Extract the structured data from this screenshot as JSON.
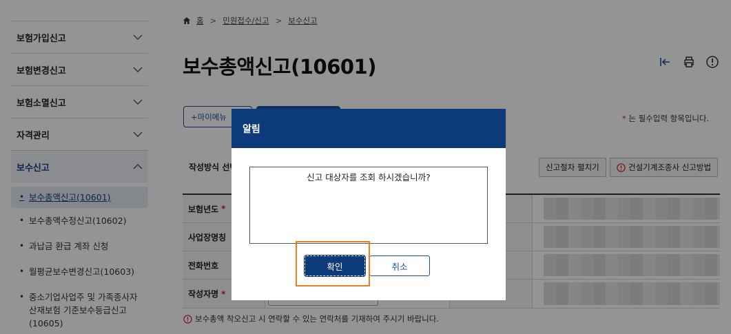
{
  "sidebar": {
    "items": [
      {
        "label": "보험가입신고"
      },
      {
        "label": "보험변경신고"
      },
      {
        "label": "보험소멸신고"
      },
      {
        "label": "자격관리"
      },
      {
        "label": "보수신고"
      }
    ],
    "sub_items": [
      {
        "label": "보수총액신고(10601)"
      },
      {
        "label": "보수총액수정신고(10602)"
      },
      {
        "label": "과납금 환급 계좌 신청"
      },
      {
        "label": "월평균보수변경신고(10603)"
      },
      {
        "label": "중소기업사업주 및 가족종사자 산재보험 기준보수등급신고(10605)"
      }
    ]
  },
  "breadcrumb": {
    "home": "홈",
    "level1": "민원접수/신고",
    "level2": "보수신고"
  },
  "page": {
    "title": "보수총액신고(10601)",
    "mymenu_label": "+마이메뉴",
    "required_note_star": "*",
    "required_note": "는 필수입력 항목입니다.",
    "method_label": "작성방식 선택",
    "proc_button": "신고절차 펼치기",
    "guide_button": "건설기계조종사 신고방법",
    "hint": "보수총액 착오신고 시 연락할 수 있는 연락처를 기재하여 주시기 바랍니다."
  },
  "form": {
    "rows": [
      {
        "label": "보험년도",
        "required": "*"
      },
      {
        "label": "사업장명칭",
        "required": ""
      },
      {
        "label": "전화번호",
        "required": ""
      },
      {
        "label": "작성자명",
        "required": "*"
      }
    ]
  },
  "dialog": {
    "title": "알림",
    "message": "신고 대상자를 조회 하시겠습니까?",
    "ok_label": "확인",
    "cancel_label": "취소"
  },
  "colors": {
    "brand": "#0d3a7a",
    "accent": "#1a4fa0",
    "highlight": "#f07c1c",
    "required": "#e02020"
  },
  "icons": [
    "home-icon",
    "collapse-left-icon",
    "print-icon",
    "info-icon",
    "chevron-down-icon",
    "chevron-up-icon",
    "warning-icon"
  ]
}
